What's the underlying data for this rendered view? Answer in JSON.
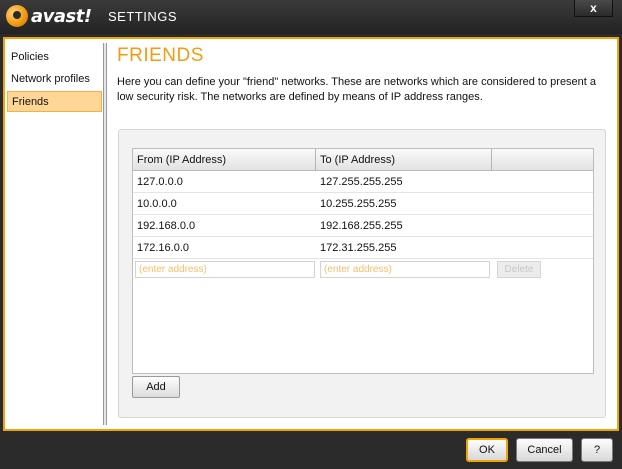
{
  "window": {
    "brand": "avast!",
    "title": "SETTINGS",
    "close_label": "x"
  },
  "sidebar": {
    "items": [
      {
        "label": "Policies",
        "active": false
      },
      {
        "label": "Network profiles",
        "active": false
      },
      {
        "label": "Friends",
        "active": true
      }
    ]
  },
  "main": {
    "title": "FRIENDS",
    "description": "Here you can define your \"friend\" networks. These are networks which are considered to present a low security risk. The networks are defined by means of IP address ranges.",
    "table": {
      "columns": [
        "From (IP Address)",
        "To (IP Address)",
        ""
      ],
      "rows": [
        {
          "from": "127.0.0.0",
          "to": "127.255.255.255"
        },
        {
          "from": "10.0.0.0",
          "to": "10.255.255.255"
        },
        {
          "from": "192.168.0.0",
          "to": "192.168.255.255"
        },
        {
          "from": "172.16.0.0",
          "to": "172.31.255.255"
        }
      ],
      "new_row": {
        "from_placeholder": "(enter address)",
        "to_placeholder": "(enter address)",
        "delete_label": "Delete"
      }
    },
    "add_label": "Add"
  },
  "footer": {
    "ok_label": "OK",
    "cancel_label": "Cancel",
    "help_label": "?"
  },
  "colors": {
    "accent": "#f39c12",
    "frame_border": "#f0a500",
    "selected_bg": "#ffd694"
  }
}
